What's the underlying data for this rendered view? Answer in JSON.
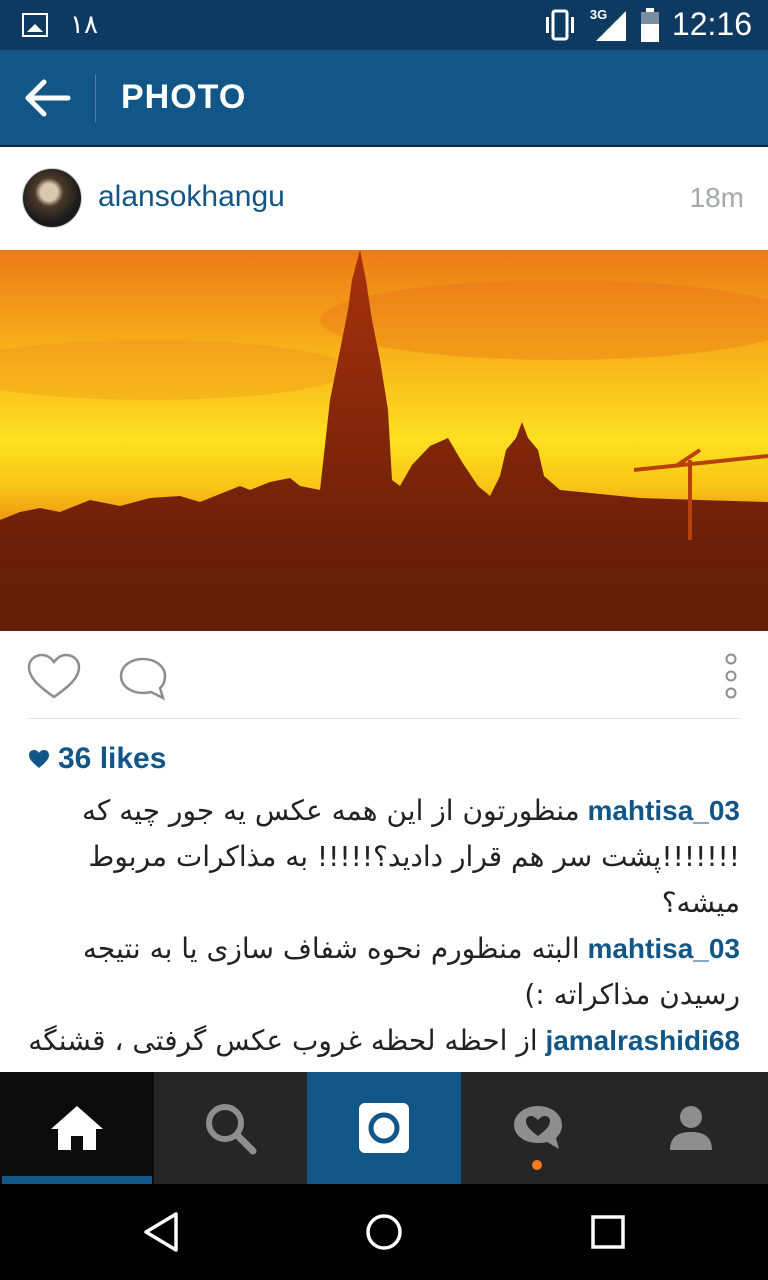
{
  "status_bar": {
    "notification_count": "١٨",
    "network": "3G",
    "time": "12:16"
  },
  "app_bar": {
    "title": "PHOTO"
  },
  "post": {
    "username": "alansokhangu",
    "timestamp": "18m",
    "likes": "36 likes",
    "comments": [
      {
        "author": "mahtisa_03",
        "text": "منظورتون از این همه عکس یه جور چیه که !!!!!!!پشت سر هم قرار دادید؟!!!!! به مذاکرات مربوط میشه؟"
      },
      {
        "author": "mahtisa_03",
        "text": "البته منظورم نحوه شفاف سازی یا به نتیجه رسیدن مذاکراته :)"
      },
      {
        "author": "jamalrashidi68",
        "text": "از احظه لحظه غروب عکس گرفتی ، قشنگه"
      }
    ]
  },
  "tab_bar": {
    "tabs": [
      "home",
      "search",
      "camera",
      "activity",
      "profile"
    ],
    "active": "home",
    "accent": "#125688",
    "notification_color": "#f47b20"
  },
  "colors": {
    "status_bar": "#0e3a61",
    "app_bar": "#125688",
    "link": "#125688"
  }
}
